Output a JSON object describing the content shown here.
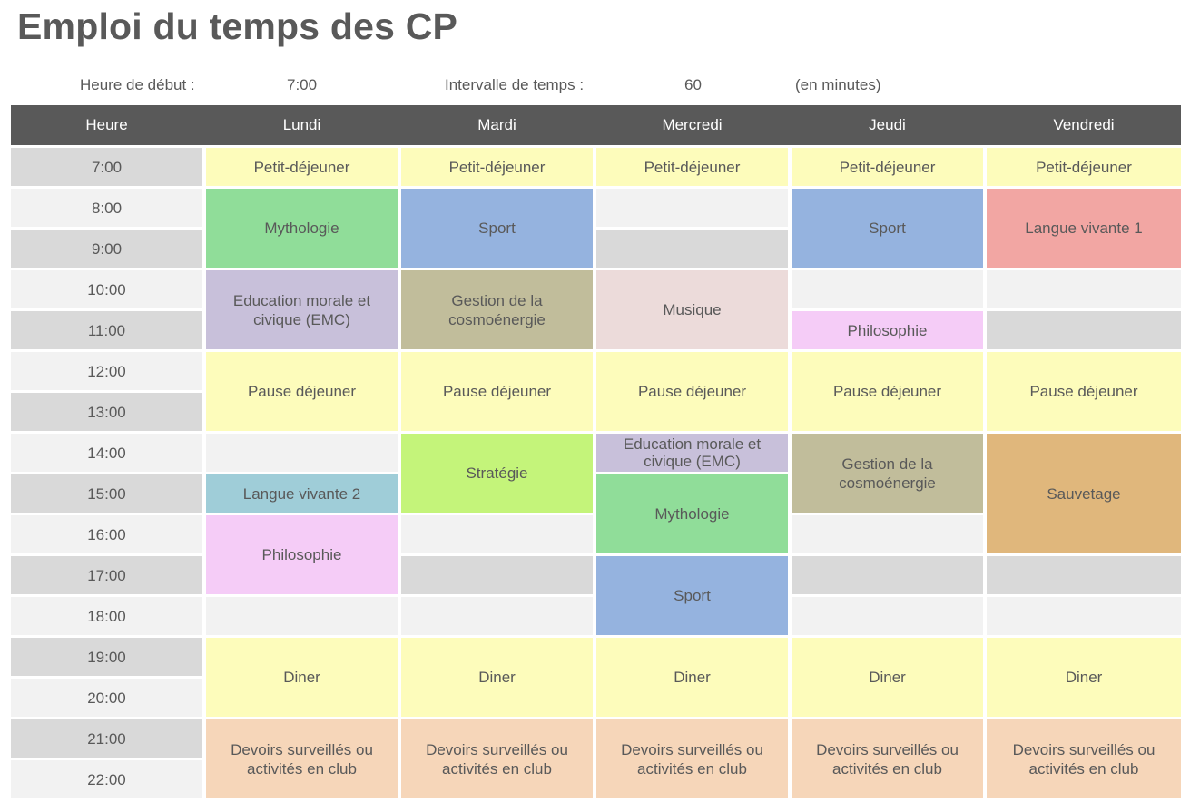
{
  "title": "Emploi du temps des CP",
  "params": {
    "start_label": "Heure de début :",
    "start_value": "7:00",
    "interval_label": "Intervalle de temps :",
    "interval_value": "60",
    "interval_unit": "(en minutes)"
  },
  "headers": [
    "Heure",
    "Lundi",
    "Mardi",
    "Mercredi",
    "Jeudi",
    "Vendredi"
  ],
  "times": [
    "7:00",
    "8:00",
    "9:00",
    "10:00",
    "11:00",
    "12:00",
    "13:00",
    "14:00",
    "15:00",
    "16:00",
    "17:00",
    "18:00",
    "19:00",
    "20:00",
    "21:00",
    "22:00"
  ],
  "colors": {
    "header_bg": "#595959",
    "header_text": "#ffffff",
    "row_dark": "#d9d9d9",
    "row_light": "#f2f2f2",
    "meal": "#fdfcbb",
    "mythologie": "#90dd99",
    "sport": "#95b3df",
    "langue_vivante_1": "#f2a6a3",
    "emc": "#c8c0da",
    "cosmoenergie": "#c1bd9b",
    "musique": "#ecdbda",
    "philosophie": "#f5ccf7",
    "strategie": "#c4f47a",
    "langue_vivante_2": "#9fcdd8",
    "sauvetage": "#e0b77c",
    "devoirs": "#f6d6b9"
  },
  "schedule": [
    {
      "day": 1,
      "start": 0,
      "span": 1,
      "label": "Petit-déjeuner",
      "color": "#fdfcbb"
    },
    {
      "day": 1,
      "start": 1,
      "span": 2,
      "label": "Mythologie",
      "color": "#90dd99"
    },
    {
      "day": 1,
      "start": 3,
      "span": 2,
      "label": "Education morale et civique (EMC)",
      "color": "#c8c0da"
    },
    {
      "day": 1,
      "start": 5,
      "span": 2,
      "label": "Pause déjeuner",
      "color": "#fdfcbb"
    },
    {
      "day": 1,
      "start": 8,
      "span": 1,
      "label": "Langue vivante 2",
      "color": "#9fcdd8"
    },
    {
      "day": 1,
      "start": 9,
      "span": 2,
      "label": "Philosophie",
      "color": "#f5ccf7"
    },
    {
      "day": 1,
      "start": 12,
      "span": 2,
      "label": "Diner",
      "color": "#fdfcbb"
    },
    {
      "day": 1,
      "start": 14,
      "span": 2,
      "label": "Devoirs surveillés ou activités en club",
      "color": "#f6d6b9"
    },
    {
      "day": 2,
      "start": 0,
      "span": 1,
      "label": "Petit-déjeuner",
      "color": "#fdfcbb"
    },
    {
      "day": 2,
      "start": 1,
      "span": 2,
      "label": "Sport",
      "color": "#95b3df"
    },
    {
      "day": 2,
      "start": 3,
      "span": 2,
      "label": "Gestion de la cosmoénergie",
      "color": "#c1bd9b"
    },
    {
      "day": 2,
      "start": 5,
      "span": 2,
      "label": "Pause déjeuner",
      "color": "#fdfcbb"
    },
    {
      "day": 2,
      "start": 7,
      "span": 2,
      "label": "Stratégie",
      "color": "#c4f47a"
    },
    {
      "day": 2,
      "start": 12,
      "span": 2,
      "label": "Diner",
      "color": "#fdfcbb"
    },
    {
      "day": 2,
      "start": 14,
      "span": 2,
      "label": "Devoirs surveillés ou activités en club",
      "color": "#f6d6b9"
    },
    {
      "day": 3,
      "start": 0,
      "span": 1,
      "label": "Petit-déjeuner",
      "color": "#fdfcbb"
    },
    {
      "day": 3,
      "start": 3,
      "span": 2,
      "label": "Musique",
      "color": "#ecdbda"
    },
    {
      "day": 3,
      "start": 5,
      "span": 2,
      "label": "Pause déjeuner",
      "color": "#fdfcbb"
    },
    {
      "day": 3,
      "start": 7,
      "span": 1,
      "label": "Education morale et civique (EMC)",
      "color": "#c8c0da"
    },
    {
      "day": 3,
      "start": 8,
      "span": 2,
      "label": "Mythologie",
      "color": "#90dd99"
    },
    {
      "day": 3,
      "start": 10,
      "span": 2,
      "label": "Sport",
      "color": "#95b3df"
    },
    {
      "day": 3,
      "start": 12,
      "span": 2,
      "label": "Diner",
      "color": "#fdfcbb"
    },
    {
      "day": 3,
      "start": 14,
      "span": 2,
      "label": "Devoirs surveillés ou activités en club",
      "color": "#f6d6b9"
    },
    {
      "day": 4,
      "start": 0,
      "span": 1,
      "label": "Petit-déjeuner",
      "color": "#fdfcbb"
    },
    {
      "day": 4,
      "start": 1,
      "span": 2,
      "label": "Sport",
      "color": "#95b3df"
    },
    {
      "day": 4,
      "start": 4,
      "span": 1,
      "label": "Philosophie",
      "color": "#f5ccf7"
    },
    {
      "day": 4,
      "start": 5,
      "span": 2,
      "label": "Pause déjeuner",
      "color": "#fdfcbb"
    },
    {
      "day": 4,
      "start": 7,
      "span": 2,
      "label": "Gestion de la cosmoénergie",
      "color": "#c1bd9b"
    },
    {
      "day": 4,
      "start": 12,
      "span": 2,
      "label": "Diner",
      "color": "#fdfcbb"
    },
    {
      "day": 4,
      "start": 14,
      "span": 2,
      "label": "Devoirs surveillés ou activités en club",
      "color": "#f6d6b9"
    },
    {
      "day": 5,
      "start": 0,
      "span": 1,
      "label": "Petit-déjeuner",
      "color": "#fdfcbb"
    },
    {
      "day": 5,
      "start": 1,
      "span": 2,
      "label": "Langue vivante 1",
      "color": "#f2a6a3"
    },
    {
      "day": 5,
      "start": 5,
      "span": 2,
      "label": "Pause déjeuner",
      "color": "#fdfcbb"
    },
    {
      "day": 5,
      "start": 7,
      "span": 3,
      "label": "Sauvetage",
      "color": "#e0b77c"
    },
    {
      "day": 5,
      "start": 12,
      "span": 2,
      "label": "Diner",
      "color": "#fdfcbb"
    },
    {
      "day": 5,
      "start": 14,
      "span": 2,
      "label": "Devoirs surveillés ou activités en club",
      "color": "#f6d6b9"
    }
  ]
}
